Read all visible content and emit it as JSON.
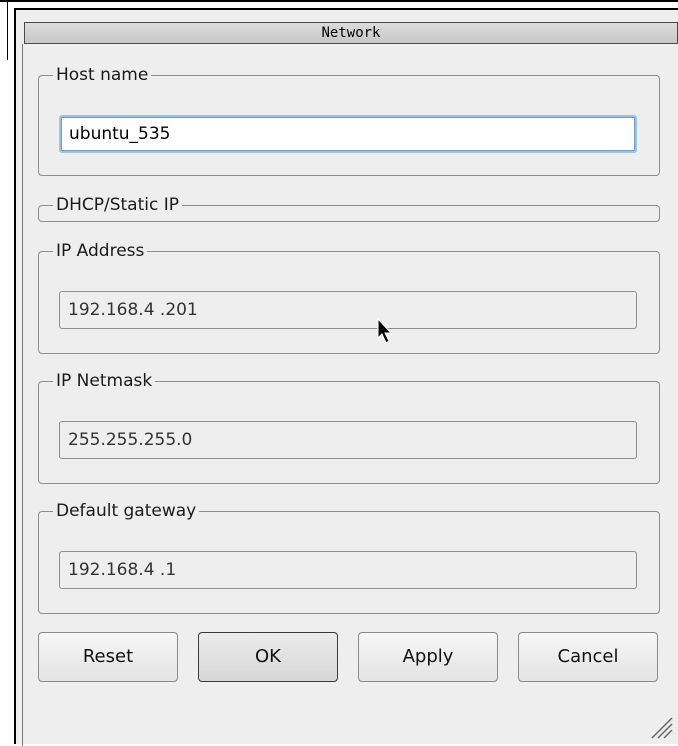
{
  "window": {
    "title": "Network"
  },
  "host_name": {
    "legend": "Host name",
    "value": "ubuntu_535"
  },
  "dhcp_static": {
    "legend": "DHCP/Static IP"
  },
  "ip_address": {
    "legend": "IP Address",
    "value": "192.168.4  .201"
  },
  "ip_netmask": {
    "legend": "IP Netmask",
    "value": "255.255.255.0"
  },
  "default_gateway": {
    "legend": "Default gateway",
    "value": "192.168.4  .1"
  },
  "buttons": {
    "reset": "Reset",
    "ok": "OK",
    "apply": "Apply",
    "cancel": "Cancel"
  },
  "colors": {
    "focus_border": "#9cc3e6",
    "window_bg": "#eeeeee",
    "titlebar_bg": "#d0d0d0"
  }
}
